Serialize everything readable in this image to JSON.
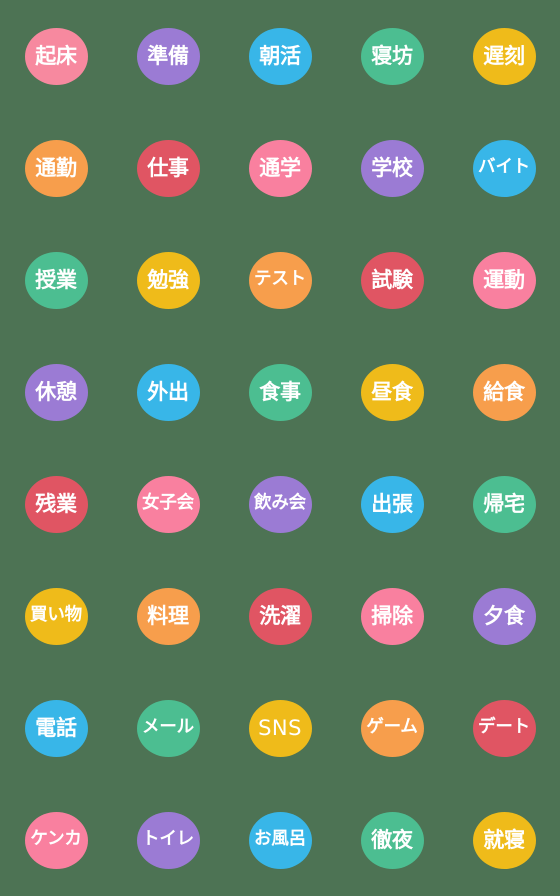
{
  "sheet": {
    "title": "Daily Life Japanese Emoji Sticker Sheet",
    "background_color": "#4d7354",
    "label_color": "#ffffff",
    "columns": 5,
    "rows": 8,
    "sticker_count": 40,
    "bubble_shape": "ellipse"
  },
  "palette": {
    "pink": "#f7899f",
    "purple": "#9b7bd4",
    "blue": "#38b6e8",
    "green": "#4cbe91",
    "gold": "#efbb1a",
    "orange": "#f79e4c",
    "red": "#e05563",
    "hotpink": "#f9809f"
  },
  "stickers": [
    {
      "label": "起床",
      "color": "#f7899f",
      "color_name": "pink",
      "row": 1,
      "col": 1
    },
    {
      "label": "準備",
      "color": "#9b7bd4",
      "color_name": "purple",
      "row": 1,
      "col": 2
    },
    {
      "label": "朝活",
      "color": "#38b6e8",
      "color_name": "blue",
      "row": 1,
      "col": 3
    },
    {
      "label": "寝坊",
      "color": "#4cbe91",
      "color_name": "green",
      "row": 1,
      "col": 4
    },
    {
      "label": "遅刻",
      "color": "#efbb1a",
      "color_name": "gold",
      "row": 1,
      "col": 5
    },
    {
      "label": "通勤",
      "color": "#f79e4c",
      "color_name": "orange",
      "row": 2,
      "col": 1
    },
    {
      "label": "仕事",
      "color": "#e05563",
      "color_name": "red",
      "row": 2,
      "col": 2
    },
    {
      "label": "通学",
      "color": "#f9809f",
      "color_name": "hotpink",
      "row": 2,
      "col": 3
    },
    {
      "label": "学校",
      "color": "#9b7bd4",
      "color_name": "purple",
      "row": 2,
      "col": 4
    },
    {
      "label": "バイト",
      "color": "#38b6e8",
      "color_name": "blue",
      "row": 2,
      "col": 5
    },
    {
      "label": "授業",
      "color": "#4cbe91",
      "color_name": "green",
      "row": 3,
      "col": 1
    },
    {
      "label": "勉強",
      "color": "#efbb1a",
      "color_name": "gold",
      "row": 3,
      "col": 2
    },
    {
      "label": "テスト",
      "color": "#f79e4c",
      "color_name": "orange",
      "row": 3,
      "col": 3
    },
    {
      "label": "試験",
      "color": "#e05563",
      "color_name": "red",
      "row": 3,
      "col": 4
    },
    {
      "label": "運動",
      "color": "#f9809f",
      "color_name": "hotpink",
      "row": 3,
      "col": 5
    },
    {
      "label": "休憩",
      "color": "#9b7bd4",
      "color_name": "purple",
      "row": 4,
      "col": 1
    },
    {
      "label": "外出",
      "color": "#38b6e8",
      "color_name": "blue",
      "row": 4,
      "col": 2
    },
    {
      "label": "食事",
      "color": "#4cbe91",
      "color_name": "green",
      "row": 4,
      "col": 3
    },
    {
      "label": "昼食",
      "color": "#efbb1a",
      "color_name": "gold",
      "row": 4,
      "col": 4
    },
    {
      "label": "給食",
      "color": "#f79e4c",
      "color_name": "orange",
      "row": 4,
      "col": 5
    },
    {
      "label": "残業",
      "color": "#e05563",
      "color_name": "red",
      "row": 5,
      "col": 1
    },
    {
      "label": "女子会",
      "color": "#f9809f",
      "color_name": "hotpink",
      "row": 5,
      "col": 2
    },
    {
      "label": "飲み会",
      "color": "#9b7bd4",
      "color_name": "purple",
      "row": 5,
      "col": 3
    },
    {
      "label": "出張",
      "color": "#38b6e8",
      "color_name": "blue",
      "row": 5,
      "col": 4
    },
    {
      "label": "帰宅",
      "color": "#4cbe91",
      "color_name": "green",
      "row": 5,
      "col": 5
    },
    {
      "label": "買い物",
      "color": "#efbb1a",
      "color_name": "gold",
      "row": 6,
      "col": 1
    },
    {
      "label": "料理",
      "color": "#f79e4c",
      "color_name": "orange",
      "row": 6,
      "col": 2
    },
    {
      "label": "洗濯",
      "color": "#e05563",
      "color_name": "red",
      "row": 6,
      "col": 3
    },
    {
      "label": "掃除",
      "color": "#f9809f",
      "color_name": "hotpink",
      "row": 6,
      "col": 4
    },
    {
      "label": "夕食",
      "color": "#9b7bd4",
      "color_name": "purple",
      "row": 6,
      "col": 5
    },
    {
      "label": "電話",
      "color": "#38b6e8",
      "color_name": "blue",
      "row": 7,
      "col": 1
    },
    {
      "label": "メール",
      "color": "#4cbe91",
      "color_name": "green",
      "row": 7,
      "col": 2
    },
    {
      "label": "SNS",
      "color": "#efbb1a",
      "color_name": "gold",
      "row": 7,
      "col": 3
    },
    {
      "label": "ゲーム",
      "color": "#f79e4c",
      "color_name": "orange",
      "row": 7,
      "col": 4
    },
    {
      "label": "デート",
      "color": "#e05563",
      "color_name": "red",
      "row": 7,
      "col": 5
    },
    {
      "label": "ケンカ",
      "color": "#f9809f",
      "color_name": "hotpink",
      "row": 8,
      "col": 1
    },
    {
      "label": "トイレ",
      "color": "#9b7bd4",
      "color_name": "purple",
      "row": 8,
      "col": 2
    },
    {
      "label": "お風呂",
      "color": "#38b6e8",
      "color_name": "blue",
      "row": 8,
      "col": 3
    },
    {
      "label": "徹夜",
      "color": "#4cbe91",
      "color_name": "green",
      "row": 8,
      "col": 4
    },
    {
      "label": "就寝",
      "color": "#efbb1a",
      "color_name": "gold",
      "row": 8,
      "col": 5
    }
  ]
}
